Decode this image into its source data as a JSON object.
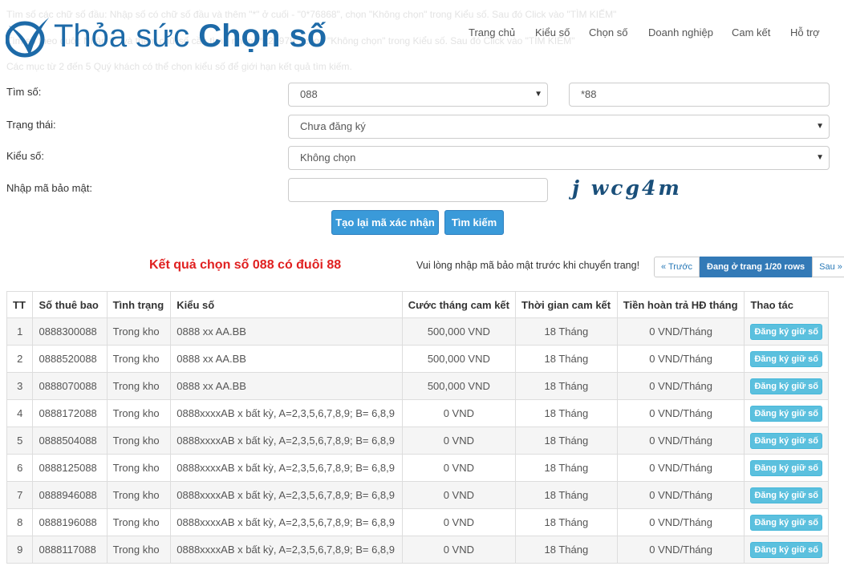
{
  "background_hints": [
    "Tìm số các chữ số đầu: Nhập số có chữ số đầu và thêm \"*\" ở cuối - \"0*76868\", chọn \"Không chọn\" trong Kiểu số. Sau đó Click vào \"TÌM KIẾM\"",
    "Tìm số theo đuôi: Nhập \"*\" và thêm chữ số cần tìm - nhập \"*227979\", chọn \"Không chọn\" trong Kiểu số. Sau đó Click vào \"TÌM KIẾM\"",
    "Các mục từ 2 đến 5 Quý khách có thể chọn kiểu số để giới hạn kết quả tìm kiếm."
  ],
  "logo": {
    "text_regular": "Thỏa sức ",
    "text_bold": "Chọn số",
    "color": "#1d6aa8"
  },
  "nav": [
    "Trang chủ",
    "Kiểu số",
    "Chọn số",
    "Doanh nghiệp",
    "Cam kết",
    "Hỗ trợ"
  ],
  "form": {
    "find_label": "Tìm số:",
    "prefix_value": "088",
    "pattern_value": "*88",
    "status_label": "Trạng thái:",
    "status_value": "Chưa đăng ký",
    "type_label": "Kiểu số:",
    "type_value": "Không chọn",
    "captcha_label": "Nhập mã bảo mật:",
    "captcha_value": "",
    "captcha_text": "j wcg4m",
    "refresh_button": "Tạo lại mã xác nhận",
    "search_button": "Tìm kiếm"
  },
  "results": {
    "title": "Kết quả chọn số 088 có đuôi 88",
    "note": "Vui lòng nhập mã bảo mật trước khi chuyển trang!",
    "pager": {
      "prev": "« Trước",
      "current": "Đang ở trang 1/20 rows",
      "next": "Sau »"
    }
  },
  "table": {
    "headers": [
      "TT",
      "Số thuê bao",
      "Tình trạng",
      "Kiểu số",
      "Cước tháng cam kết",
      "Thời gian cam kết",
      "Tiền hoàn trả HĐ tháng",
      "Thao tác"
    ],
    "rows": [
      [
        "1",
        "0888300088",
        "Trong kho",
        "0888 xx AA.BB",
        "500,000 VND",
        "18 Tháng",
        "0 VND/Tháng",
        "Đăng ký giữ số"
      ],
      [
        "2",
        "0888520088",
        "Trong kho",
        "0888 xx AA.BB",
        "500,000 VND",
        "18 Tháng",
        "0 VND/Tháng",
        "Đăng ký giữ số"
      ],
      [
        "3",
        "0888070088",
        "Trong kho",
        "0888 xx AA.BB",
        "500,000 VND",
        "18 Tháng",
        "0 VND/Tháng",
        "Đăng ký giữ số"
      ],
      [
        "4",
        "0888172088",
        "Trong kho",
        "0888xxxxAB x bất kỳ, A=2,3,5,6,7,8,9; B= 6,8,9",
        "0 VND",
        "18 Tháng",
        "0 VND/Tháng",
        "Đăng ký giữ số"
      ],
      [
        "5",
        "0888504088",
        "Trong kho",
        "0888xxxxAB x bất kỳ, A=2,3,5,6,7,8,9; B= 6,8,9",
        "0 VND",
        "18 Tháng",
        "0 VND/Tháng",
        "Đăng ký giữ số"
      ],
      [
        "6",
        "0888125088",
        "Trong kho",
        "0888xxxxAB x bất kỳ, A=2,3,5,6,7,8,9; B= 6,8,9",
        "0 VND",
        "18 Tháng",
        "0 VND/Tháng",
        "Đăng ký giữ số"
      ],
      [
        "7",
        "0888946088",
        "Trong kho",
        "0888xxxxAB x bất kỳ, A=2,3,5,6,7,8,9; B= 6,8,9",
        "0 VND",
        "18 Tháng",
        "0 VND/Tháng",
        "Đăng ký giữ số"
      ],
      [
        "8",
        "0888196088",
        "Trong kho",
        "0888xxxxAB x bất kỳ, A=2,3,5,6,7,8,9; B= 6,8,9",
        "0 VND",
        "18 Tháng",
        "0 VND/Tháng",
        "Đăng ký giữ số"
      ],
      [
        "9",
        "0888117088",
        "Trong kho",
        "0888xxxxAB x bất kỳ, A=2,3,5,6,7,8,9; B= 6,8,9",
        "0 VND",
        "18 Tháng",
        "0 VND/Tháng",
        "Đăng ký giữ số"
      ]
    ]
  },
  "colors": {
    "accent": "#3a9ad9",
    "result_title": "#e02020",
    "register_button": "#5bc0de"
  }
}
